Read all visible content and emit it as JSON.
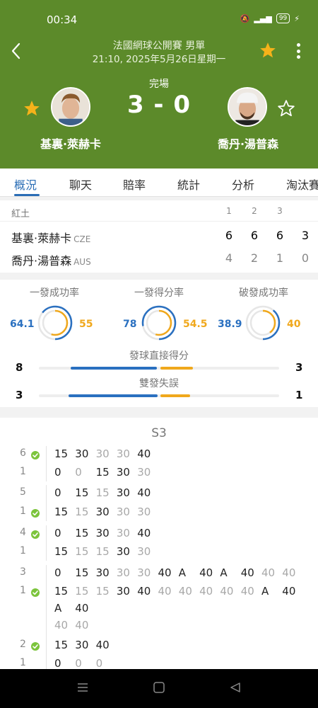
{
  "status_bar": {
    "time": "00:34",
    "battery": "99"
  },
  "header": {
    "tournament": "法國網球公開賽 男單",
    "datetime": "21:10, 2025年5月26日星期一",
    "match_status": "完場",
    "score": "3 - 0",
    "home_player": "基裏·萊赫卡",
    "away_player": "喬丹·湯普森"
  },
  "tabs": [
    "概況",
    "聊天",
    "賠率",
    "統計",
    "分析",
    "淘汰賽"
  ],
  "scoreboard": {
    "surface": "紅土",
    "set_headers": [
      "1",
      "2",
      "3"
    ],
    "rows": [
      {
        "name": "基裏·萊赫卡",
        "country": "CZE",
        "sets": [
          "6",
          "6",
          "6"
        ],
        "total": "3"
      },
      {
        "name": "喬丹·湯普森",
        "country": "AUS",
        "sets": [
          "4",
          "2",
          "1"
        ],
        "total": "0"
      }
    ]
  },
  "stats": {
    "rings": [
      {
        "title": "一發成功率",
        "home": "64.1",
        "away": "55"
      },
      {
        "title": "一發得分率",
        "home": "78",
        "away": "54.5"
      },
      {
        "title": "破發成功率",
        "home": "38.9",
        "away": "40"
      }
    ],
    "bars": [
      {
        "title": "發球直接得分",
        "home": "8",
        "away": "3"
      },
      {
        "title": "雙發失誤",
        "home": "3",
        "away": "1"
      }
    ]
  },
  "pbp": {
    "set_label": "S3",
    "games": [
      {
        "top_num": "6",
        "bottom_num": "1",
        "check": "top",
        "top": [
          "15",
          "30",
          "30",
          "30",
          "40"
        ],
        "bottom": [
          "0",
          "0",
          "15",
          "30",
          "30"
        ]
      },
      {
        "top_num": "5",
        "bottom_num": "1",
        "check": "bottom",
        "top": [
          "0",
          "15",
          "15",
          "30",
          "40"
        ],
        "bottom": [
          "15",
          "15",
          "30",
          "30",
          "30"
        ]
      },
      {
        "top_num": "4",
        "bottom_num": "1",
        "check": "top",
        "top": [
          "0",
          "15",
          "30",
          "30",
          "40"
        ],
        "bottom": [
          "15",
          "15",
          "15",
          "30",
          "30"
        ]
      },
      {
        "top_num": "3",
        "bottom_num": "1",
        "check": "bottom",
        "top": [
          "0",
          "15",
          "30",
          "30",
          "30",
          "40",
          "A",
          "40",
          "A",
          "40",
          "40",
          "40"
        ],
        "bottom": [
          "15",
          "15",
          "15",
          "30",
          "40",
          "40",
          "40",
          "40",
          "40",
          "40",
          "A",
          "40"
        ],
        "bottom_wrap": [
          "A",
          "40"
        ],
        "bottom_wrap2": [
          "40",
          "40"
        ]
      },
      {
        "top_num": "2",
        "bottom_num": "1",
        "check": "top",
        "top": [
          "15",
          "30",
          "40"
        ],
        "bottom": [
          "0",
          "0",
          "0"
        ]
      }
    ]
  },
  "colors": {
    "header_green": "#5c8a2a",
    "accent_blue": "#2a70c0",
    "accent_orange": "#f0a81c",
    "star": "#f5b21a",
    "check_green": "#7cc43c"
  },
  "icons": [
    "back-arrow-icon",
    "star-icon",
    "more-vert-icon",
    "star-outline-icon",
    "check-icon",
    "menu-icon",
    "home-square-icon",
    "back-triangle-icon"
  ]
}
